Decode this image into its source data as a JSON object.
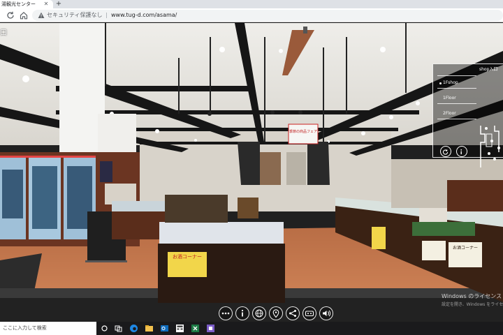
{
  "browser": {
    "tab_title": "湯観光センター",
    "security_label": "セキュリティ保護なし",
    "url": "www.tug-d.com/asama/"
  },
  "tour": {
    "entrance_label": "口",
    "floor_panel": {
      "title": "shop入口",
      "floors": [
        "1Fshop",
        "1Floor",
        "2Floor"
      ]
    },
    "controls": [
      "more-icon",
      "info-icon",
      "globe-icon",
      "location-pin-icon",
      "share-icon",
      "vr-icon",
      "sound-icon"
    ],
    "signs": {
      "hanging_sign": "季節の商品フェア",
      "sake_sign_title": "お酒コーナー",
      "sake_pop_title": "お酒コーナー"
    }
  },
  "watermark": {
    "line1": "Windows のライセンス",
    "line2": "設定を開き、Windows をライセンス認証"
  },
  "taskbar": {
    "search_placeholder": "ここに入力して検索"
  },
  "colors": {
    "floor": "#c9774a",
    "ceiling": "#e9e6e0",
    "beam": "#161616",
    "accent_sign": "#f2d64a"
  }
}
